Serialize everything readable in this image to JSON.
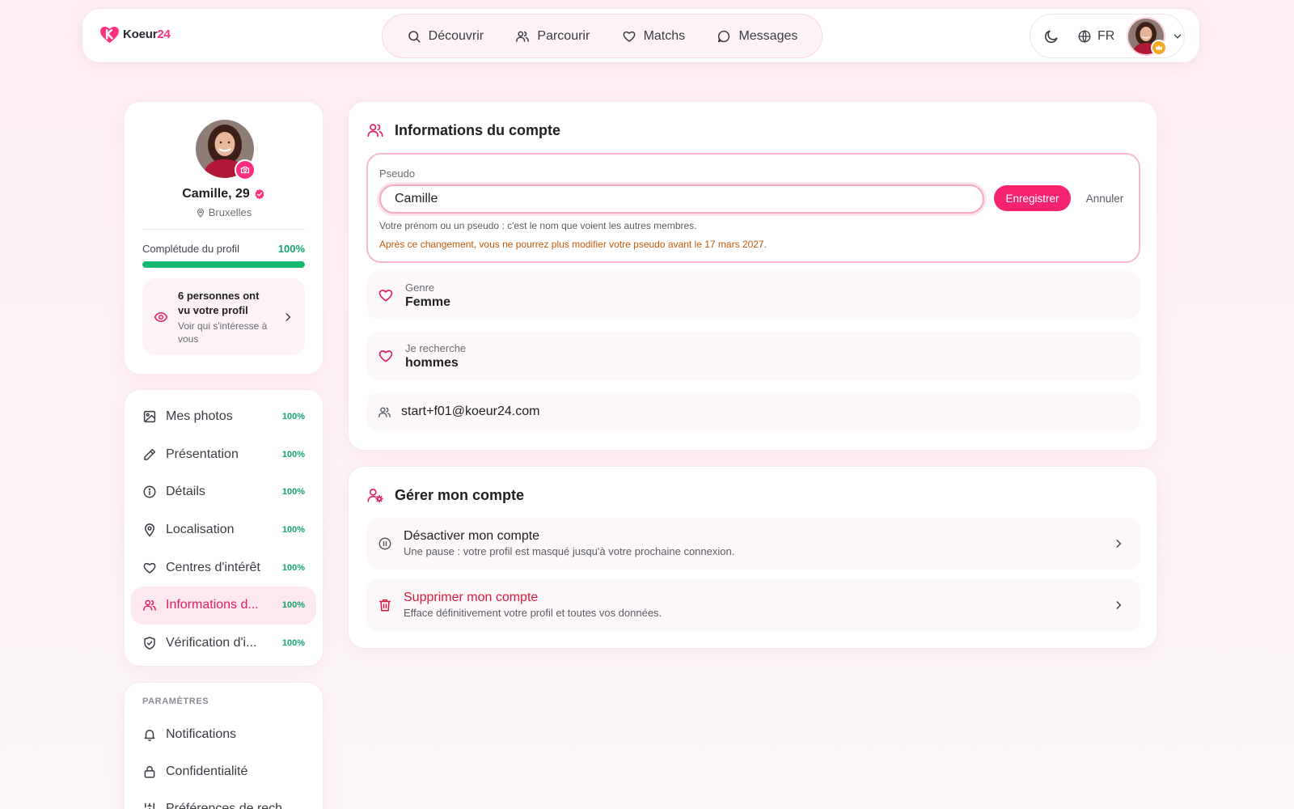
{
  "brand": {
    "name": "Koeur",
    "number": "24",
    "accent": "#ff2e7e"
  },
  "nav": {
    "items": [
      {
        "label": "Découvrir",
        "icon": "search-icon"
      },
      {
        "label": "Parcourir",
        "icon": "users-icon"
      },
      {
        "label": "Matchs",
        "icon": "heart-icon"
      },
      {
        "label": "Messages",
        "icon": "chat-icon"
      }
    ],
    "language": "FR"
  },
  "profile": {
    "name": "Camille, 29",
    "city": "Bruxelles",
    "completion_label": "Complétude du profil",
    "completion_value": "100%",
    "completion_fraction": 1.0,
    "views_title": "6 personnes ont vu votre profil",
    "views_sub": "Voir qui s'intéresse à vous"
  },
  "sections": [
    {
      "label": "Mes photos",
      "pct": "100%",
      "icon": "image-icon"
    },
    {
      "label": "Présentation",
      "pct": "100%",
      "icon": "pencil-icon"
    },
    {
      "label": "Détails",
      "pct": "100%",
      "icon": "info-icon"
    },
    {
      "label": "Localisation",
      "pct": "100%",
      "icon": "map-pin-icon"
    },
    {
      "label": "Centres d'intérêt",
      "pct": "100%",
      "icon": "heart-icon"
    },
    {
      "label": "Informations d...",
      "pct": "100%",
      "icon": "users-icon",
      "active": true
    },
    {
      "label": "Vérification d'i...",
      "pct": "100%",
      "icon": "shield-check-icon"
    }
  ],
  "settings": {
    "heading": "PARAMÈTRES",
    "items": [
      {
        "label": "Notifications",
        "icon": "bell-icon"
      },
      {
        "label": "Confidentialité",
        "icon": "lock-icon"
      },
      {
        "label": "Préférences de rech...",
        "icon": "sliders-icon"
      }
    ]
  },
  "account": {
    "title": "Informations du compte",
    "pseudo_label": "Pseudo",
    "pseudo_value": "Camille",
    "save_label": "Enregistrer",
    "cancel_label": "Annuler",
    "pseudo_help": "Votre prénom ou un pseudo : c'est le nom que voient les autres membres.",
    "pseudo_warning": "Après ce changement, vous ne pourrez plus modifier votre pseudo avant le 17 mars 2027.",
    "gender_label": "Genre",
    "gender_value": "Femme",
    "seeking_label": "Je recherche",
    "seeking_value": "hommes",
    "email": "start+f01@koeur24.com"
  },
  "manage": {
    "title": "Gérer mon compte",
    "deactivate_title": "Désactiver mon compte",
    "deactivate_sub": "Une pause : votre profil est masqué jusqu'à votre prochaine connexion.",
    "delete_title": "Supprimer mon compte",
    "delete_sub": "Efface définitivement votre profil et toutes vos données."
  }
}
